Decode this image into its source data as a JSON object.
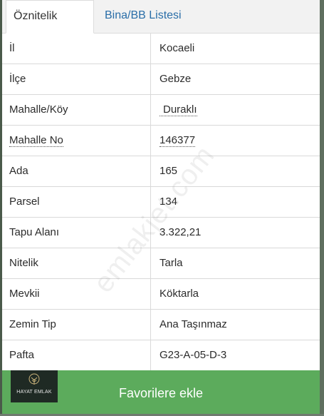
{
  "tabs": [
    {
      "label": "Öznitelik Bilgisi",
      "active": true
    },
    {
      "label": "Bina/BB Listesi",
      "active": false
    }
  ],
  "rows": [
    {
      "key": "İl",
      "value": "Kocaeli"
    },
    {
      "key": "İlçe",
      "value": "Gebze"
    },
    {
      "key": "Mahalle/Köy",
      "value": "Duraklı"
    },
    {
      "key": "Mahalle No",
      "value": "146377"
    },
    {
      "key": "Ada",
      "value": "165"
    },
    {
      "key": "Parsel",
      "value": "134"
    },
    {
      "key": "Tapu Alanı",
      "value": "3.322,21"
    },
    {
      "key": "Nitelik",
      "value": "Tarla"
    },
    {
      "key": "Mevkii",
      "value": "Köktarla"
    },
    {
      "key": "Zemin Tip",
      "value": "Ana Taşınmaz"
    },
    {
      "key": "Pafta",
      "value": "G23-A-05-D-3"
    }
  ],
  "watermark": "emlakjet.com",
  "footer": {
    "favorite_label": "Favorilere ekle",
    "logo_text": "HAYAT EMLAK",
    "logo_icon": "tree-icon"
  },
  "colors": {
    "favorite_button": "#5cab5c",
    "tab_link": "#2a6ea8"
  }
}
